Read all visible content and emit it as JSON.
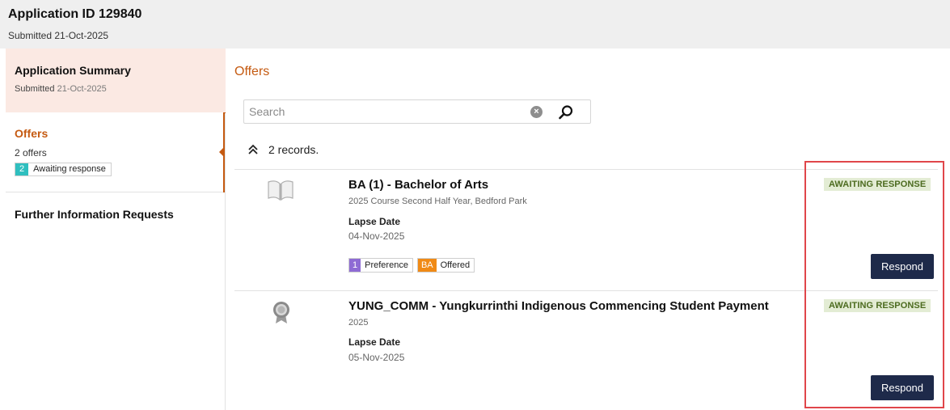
{
  "header": {
    "app_id": "Application ID 129840",
    "submitted": "Submitted 21-Oct-2025"
  },
  "sidebar": {
    "summary": {
      "title": "Application Summary",
      "submitted_label": "Submitted",
      "submitted_date": "21-Oct-2025"
    },
    "offers": {
      "title": "Offers",
      "count": "2 offers",
      "badge_count": "2",
      "badge_label": "Awaiting response"
    },
    "further": {
      "title": "Further Information Requests"
    }
  },
  "main": {
    "title": "Offers",
    "search": {
      "placeholder": "Search",
      "value": ""
    },
    "records": "2 records.",
    "offers": [
      {
        "icon": "book-icon",
        "title": "BA (1) - Bachelor of Arts",
        "subtitle": "2025 Course Second Half Year, Bedford Park",
        "lapse_label": "Lapse Date",
        "lapse_date": "04-Nov-2025",
        "status": "AWAITING RESPONSE",
        "respond_label": "Respond",
        "tags": [
          {
            "key": "1",
            "value": "Preference",
            "color": "#8e6bd4"
          },
          {
            "key": "BA",
            "value": "Offered",
            "color": "#f08a16"
          }
        ]
      },
      {
        "icon": "medal-icon",
        "title": "YUNG_COMM - Yungkurrinthi Indigenous Commencing Student Payment",
        "subtitle": "2025",
        "lapse_label": "Lapse Date",
        "lapse_date": "05-Nov-2025",
        "status": "AWAITING RESPONSE",
        "respond_label": "Respond"
      }
    ]
  },
  "colors": {
    "accent": "#c55a11",
    "status_bg": "#e3ecd4",
    "status_text": "#4c6b1f",
    "button": "#1e2a4a",
    "highlight": "#e0464a"
  }
}
